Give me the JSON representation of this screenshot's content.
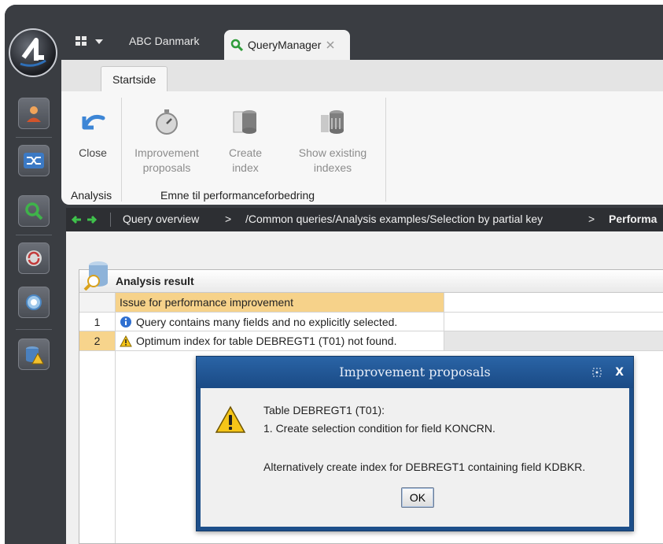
{
  "company": "ABC Danmark",
  "tab": {
    "label": "QueryManager"
  },
  "ribbon": {
    "tab_label": "Startside",
    "buttons": {
      "close": "Close",
      "improvement_1": "Improvement",
      "improvement_2": "proposals",
      "create_1": "Create",
      "create_2": "index",
      "show_1": "Show existing",
      "show_2": "indexes"
    },
    "groups": {
      "analysis": "Analysis",
      "performance": "Emne til performanceforbedring"
    }
  },
  "breadcrumb": {
    "items": [
      "Query overview",
      "/Common queries/Analysis examples/Selection by partial key",
      "Performa"
    ],
    "sep": ">"
  },
  "result": {
    "title": "Analysis result",
    "column": "Issue for performance improvement",
    "rows": [
      {
        "num": "1",
        "text": "Query contains many fields and no explicitly selected.",
        "icon": "info-icon"
      },
      {
        "num": "2",
        "text": "Optimum index for table DEBREGT1 (T01) not found.",
        "icon": "warning-icon"
      }
    ]
  },
  "dialog": {
    "title": "Improvement proposals",
    "lines": [
      "Table DEBREGT1 (T01):",
      "1. Create selection condition for field KONCRN.",
      "Alternatively create index for DEBREGT1 containing field KDBKR."
    ],
    "ok": "OK",
    "close_glyph": "X"
  },
  "colors": {
    "selected_row": "#f7d48c",
    "header_highlight": "#f6d28a",
    "dialog_title": "#1d4f8a",
    "dark_chrome": "#3a3d42"
  }
}
